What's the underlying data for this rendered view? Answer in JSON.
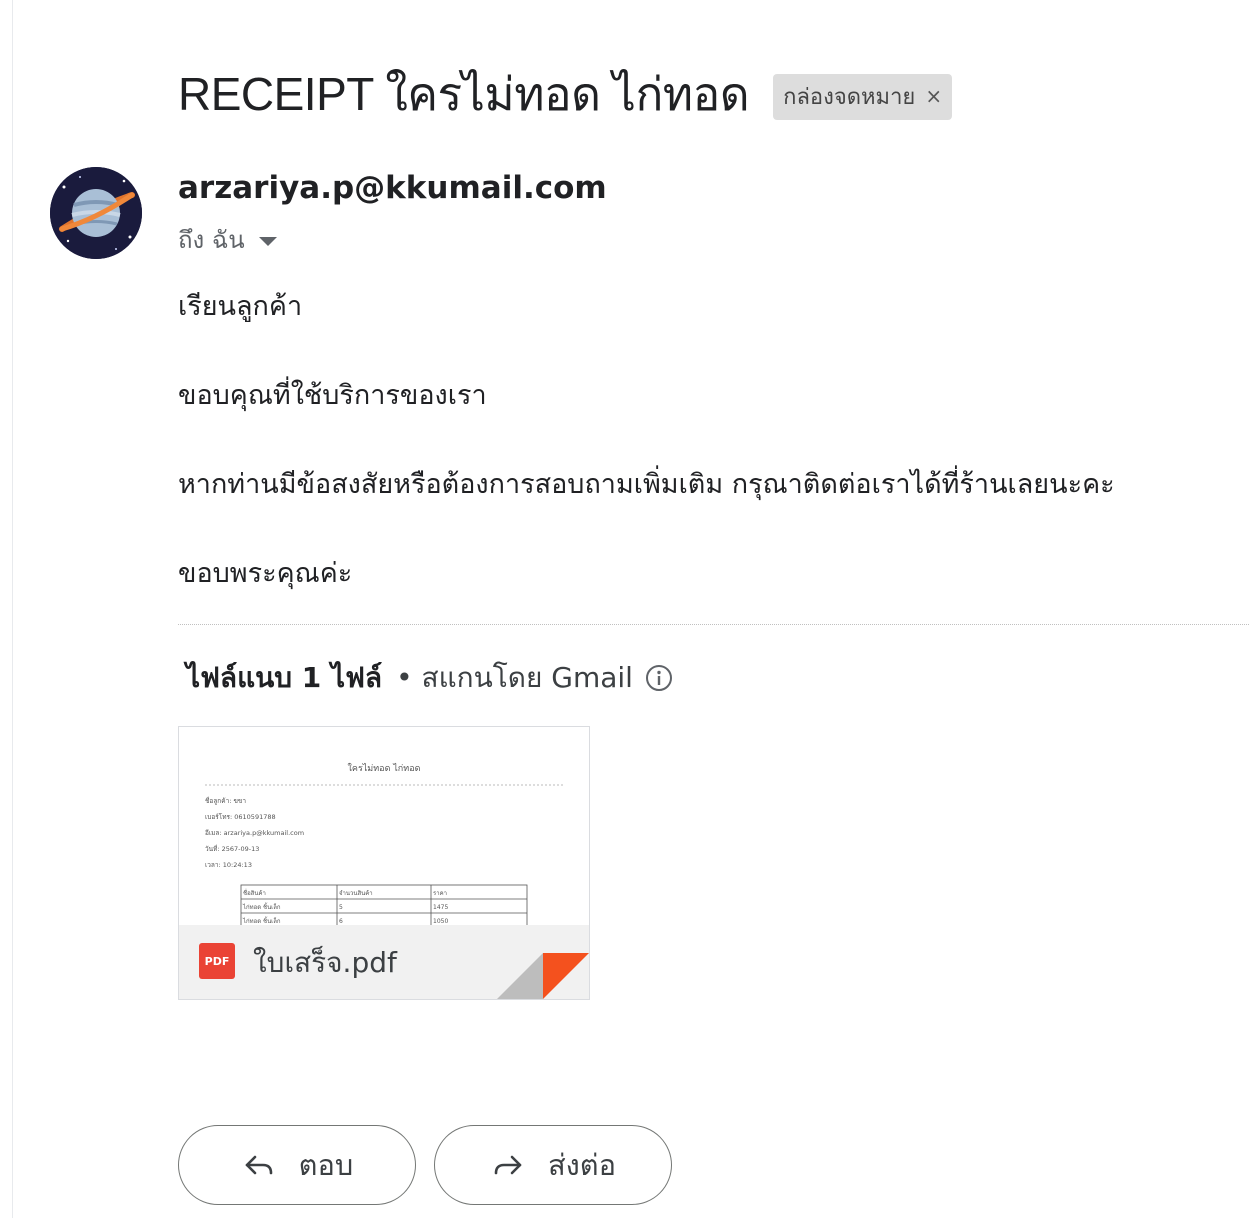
{
  "email": {
    "subject": "RECEIPT ใครไม่ทอด ไก่ทอด",
    "label_chip": "กล่องจดหมาย",
    "label_close": "×",
    "sender": "arzariya.p@kkumail.com",
    "recipient": "ถึง ฉัน"
  },
  "body": {
    "greeting": "เรียนลูกค้า",
    "thanks": "ขอบคุณที่ใช้บริการของเรา",
    "contact": "หากท่านมีข้อสงสัยหรือต้องการสอบถามเพิ่มเติม กรุณาติดต่อเราได้ที่ร้านเลยนะคะ",
    "closing": "ขอบพระคุณค่ะ"
  },
  "attachments": {
    "count_label": "ไฟล์แนบ 1 ไฟล์",
    "scan_label": "• สแกนโดย Gmail",
    "file": {
      "name": "ใบเสร็จ.pdf",
      "type_badge": "PDF",
      "preview": {
        "title": "ใครไม่ทอด ไก่ทอด",
        "lines": [
          "ชื่อลูกค้า: ขขา",
          "เบอร์โทร: 0610591788",
          "อีเมล: arzariya.p@kkumail.com",
          "วันที่: 2567-09-13",
          "เวลา: 10:24:13"
        ],
        "table_headers": [
          "ชื่อสินค้า",
          "จำนวนสินค้า",
          "ราคา"
        ],
        "table_rows": [
          [
            "ไก่ทอด ชิ้นเล็ก",
            "5",
            "1475"
          ],
          [
            "ไก่ทอด ชิ้นเล็ก",
            "6",
            "1050"
          ]
        ]
      }
    }
  },
  "actions": {
    "reply": "ตอบ",
    "forward": "ส่งต่อ"
  },
  "colors": {
    "pdf_red": "#ea4335",
    "chip_bg": "#dddddd",
    "fold_red": "#f4511e"
  }
}
